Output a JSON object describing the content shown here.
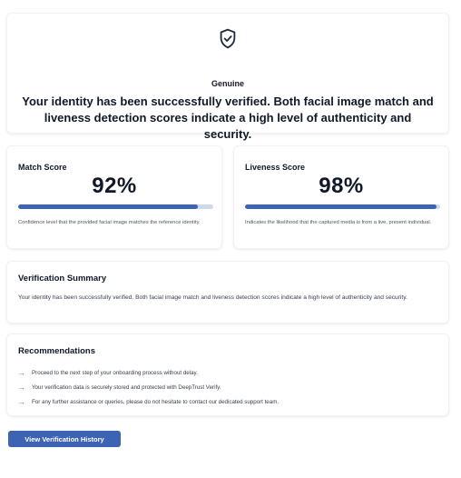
{
  "result": {
    "status": "Genuine",
    "message": "Your identity has been successfully verified. Both facial image match and liveness detection scores indicate a high level of authenticity and security."
  },
  "scores": {
    "match": {
      "title": "Match Score",
      "value_text": "92%",
      "value": 92,
      "description": "Confidence level that the provided facial image matches the reference identity."
    },
    "liveness": {
      "title": "Liveness Score",
      "value_text": "98%",
      "value": 98,
      "description": "Indicates the likelihood that the captured media is from a live, present individual."
    }
  },
  "summary": {
    "title": "Verification Summary",
    "text": "Your identity has been successfully verified. Both facial image match and liveness detection scores indicate a high level of authenticity and security."
  },
  "recommendations": {
    "title": "Recommendations",
    "items": [
      "Proceed to the next step of your onboarding process without delay.",
      "Your verification data is securely stored and protected with DeepTrust Verify.",
      "For any further assistance or queries, please do not hesitate to contact our dedicated support team."
    ]
  },
  "actions": {
    "history_label": "View Verification History"
  },
  "colors": {
    "accent": "#3d63b3",
    "bar_track": "#cfd9ec",
    "arrow": "#3b82f6"
  }
}
